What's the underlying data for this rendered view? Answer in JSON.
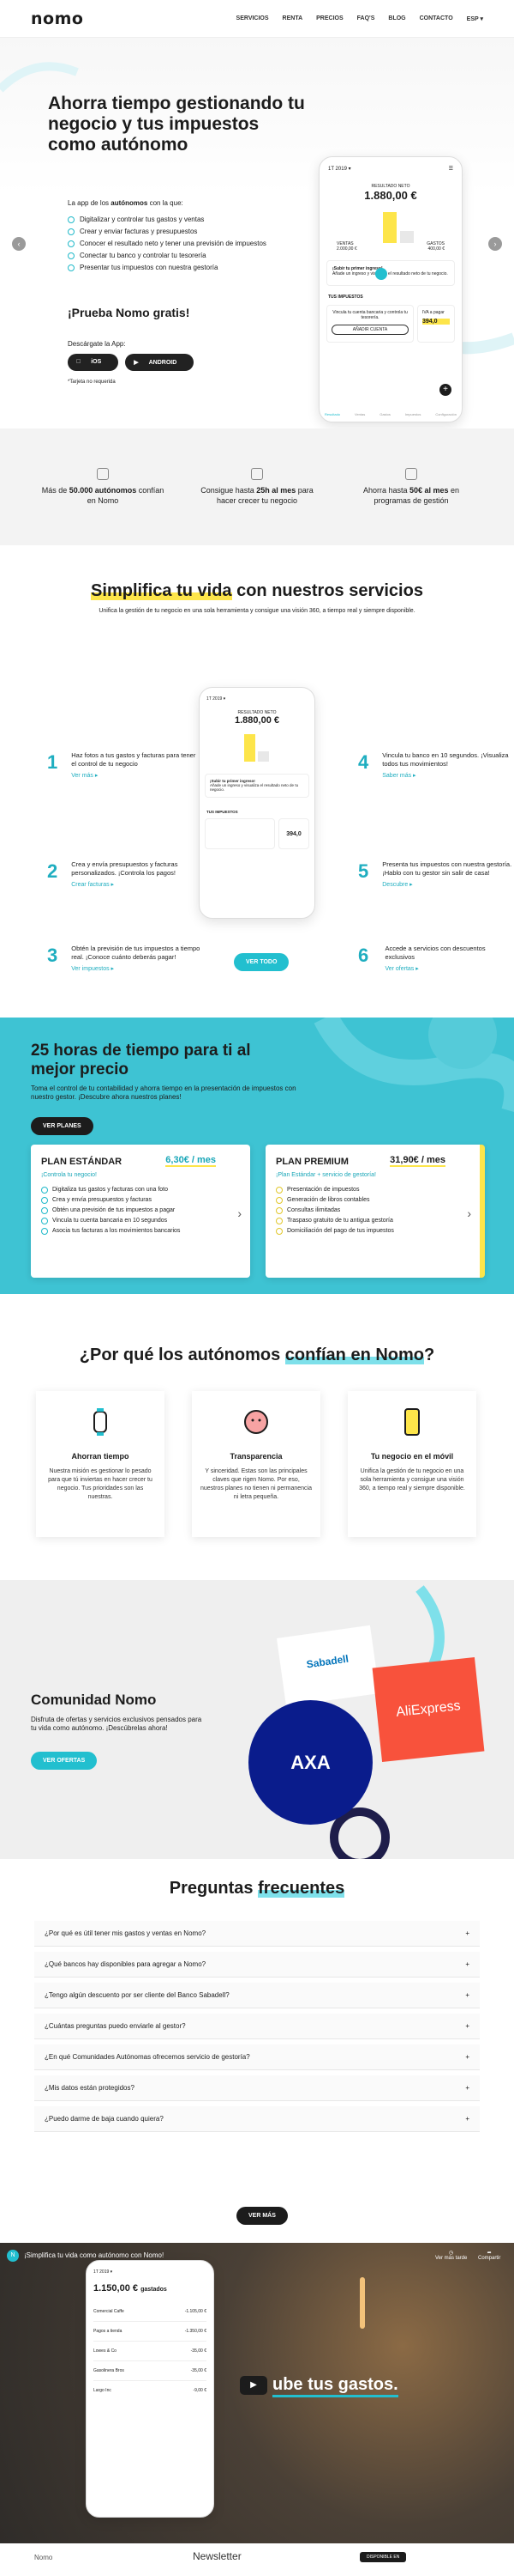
{
  "nav": {
    "logo": "nomo",
    "links": [
      "SERVICIOS",
      "RENTA",
      "PRECIOS",
      "FAQ'S",
      "BLOG",
      "CONTACTO",
      "ESP ▾"
    ]
  },
  "hero": {
    "title": "Ahorra tiempo gestionando tu negocio y tus impuestos como autónomo",
    "intro_pre": "La app de los ",
    "intro_bold": "autónomos",
    "intro_post": " con la que:",
    "bullets": [
      "Digitalizar y controlar tus gastos y ventas",
      "Crear y enviar facturas y presupuestos",
      "Conocer el resultado neto y tener una previsión de impuestos",
      "Conectar tu banco y controlar tu tesorería",
      "Presentar tus impuestos con nuestra gestoría"
    ],
    "try": "¡Prueba Nomo gratis!",
    "download": "Descárgate la App:",
    "ios": "iOS",
    "android": "ANDROID",
    "note": "*Tarjeta no requerida",
    "phone": {
      "date": "1T 2019 ▾",
      "label": "RESULTADO NETO",
      "amount": "1.880,00 €",
      "income_label": "VENTAS",
      "income": "2.000,00 €",
      "expense_label": "GASTOS",
      "expense": "400,00 €",
      "tip_title": "¡Subir tu primer ingreso!",
      "tip_text": "Añade un ingreso y visualiza el resultado neto de tu negocio.",
      "taxes": "TUS IMPUESTOS",
      "bank_text": "Vincula tu cuenta bancaria y controla tu tesorería.",
      "bank_btn": "AÑADIR CUENTA",
      "vat": "IVA a pagar",
      "vat_amount": "394,0",
      "tabs": [
        "Resultado",
        "Ventas",
        "Gastos",
        "Impuestos",
        "Configuración"
      ]
    }
  },
  "stats": [
    {
      "pre": "Más de ",
      "bold": "50.000 autónomos",
      "post": " confían en Nomo"
    },
    {
      "pre": "Consigue hasta ",
      "bold": "25h al mes",
      "post": " para hacer crecer tu negocio"
    },
    {
      "pre": "Ahorra hasta ",
      "bold": "50€ al mes",
      "post": " en programas de gestión"
    }
  ],
  "services": {
    "title_hl": "Simplifica tu vida",
    "title_rest": " con nuestros servicios",
    "sub": "Unifica la gestión de tu negocio en una sola herramienta y consigue una visión 360, a tiempo real y siempre disponible.",
    "items": [
      {
        "n": "1",
        "t": "Haz fotos a tus gastos y facturas para tener el control de tu negocio",
        "l": "Ver más ▸"
      },
      {
        "n": "2",
        "t": "Crea y envía presupuestos y facturas personalizados. ¡Controla los pagos!",
        "l": "Crear facturas ▸"
      },
      {
        "n": "3",
        "t": "Obtén la previsión de tus impuestos a tiempo real. ¡Conoce cuánto deberás pagar!",
        "l": "Ver impuestos ▸"
      },
      {
        "n": "4",
        "t": "Vincula tu banco en 10 segundos. ¡Visualiza todos tus movimientos!",
        "l": "Saber más ▸"
      },
      {
        "n": "5",
        "t": "Presenta tus impuestos con nuestra gestoría. ¡Hablo con tu gestor sin salir de casa!",
        "l": "Descubre ▸"
      },
      {
        "n": "6",
        "t": "Accede a servicios con descuentos exclusivos",
        "l": "Ver ofertas ▸"
      }
    ],
    "cta": "VER TODO"
  },
  "plans": {
    "title": "25 horas de tiempo para ti al mejor precio",
    "sub": "Toma el control de tu contabilidad y ahorra tiempo en la presentación de impuestos con nuestro gestor. ¡Descubre ahora nuestros planes!",
    "cta": "VER PLANES",
    "cards": [
      {
        "name": "PLAN ESTÁNDAR",
        "price": "6,30€ / mes",
        "sub": "¡Controla tu negocio!",
        "items": [
          "Digitaliza tus gastos y facturas con una foto",
          "Crea y envía presupuestos y facturas",
          "Obtén una previsión de tus impuestos a pagar",
          "Vincula tu cuenta bancaria en 10 segundos",
          "Asocia tus facturas a los movimientos bancarios"
        ]
      },
      {
        "name": "PLAN PREMIUM",
        "price": "31,90€ / mes",
        "sub": "¡Plan Estándar + servicio de gestoría!",
        "items": [
          "Presentación de impuestos",
          "Generación de libros contables",
          "Consultas ilimitadas",
          "Traspaso gratuito de tu antigua gestoría",
          "Domiciliación del pago de tus impuestos"
        ]
      }
    ]
  },
  "why": {
    "title_pre": "¿Por qué los autónomos ",
    "title_hl": "confían en Nomo",
    "title_post": "?",
    "cards": [
      {
        "t": "Ahorran tiempo",
        "d": "Nuestra misión es gestionar lo pesado para que tú inviertas en hacer crecer tu negocio. Tus prioridades son las nuestras."
      },
      {
        "t": "Transparencia",
        "d": "Y sinceridad. Estas son las principales claves que rigen Nomo. Por eso, nuestros planes no tienen ni permanencia ni letra pequeña."
      },
      {
        "t": "Tu negocio en el móvil",
        "d": "Unifica la gestión de tu negocio en una sola herramienta y consigue una visión 360, a tiempo real y siempre disponible."
      }
    ]
  },
  "community": {
    "title": "Comunidad Nomo",
    "text": "Disfruta de ofertas y servicios exclusivos pensados para tu vida como autónomo. ¡Descúbrelas ahora!",
    "cta": "VER OFERTAS",
    "brands": [
      "Sabadell",
      "AliExpress",
      "AXA"
    ]
  },
  "faq": {
    "title_pre": "Preguntas ",
    "title_hl": "frecuentes",
    "items": [
      "¿Por qué es útil tener mis gastos y ventas en Nomo?",
      "¿Qué bancos hay disponibles para agregar a Nomo?",
      "¿Tengo algún descuento por ser cliente del Banco Sabadell?",
      "¿Cuántas preguntas puedo enviarle al gestor?",
      "¿En qué Comunidades Autónomas ofrecemos servicio de gestoría?",
      "¿Mis datos están protegidos?",
      "¿Puedo darme de baja cuando quiera?"
    ],
    "plus": "+",
    "cta": "VER MÁS"
  },
  "video": {
    "title": "¡Simplifica tu vida como autónomo con Nomo!",
    "later": "Ver más tarde",
    "share": "Compartir",
    "caption": "ube tus gastos.",
    "amount": "1.150,00 €",
    "amount_label": "gastados",
    "rows": [
      [
        "Comercial Caffe",
        "-1.105,00 €"
      ],
      [
        "Pagos a tienda",
        "-1.350,00 €"
      ],
      [
        "Lowes & Co",
        "-35,00 €"
      ],
      [
        "Gasolinera Bros",
        "-35,00 €"
      ],
      [
        "Largo Inc",
        "-9,00 €"
      ]
    ]
  },
  "footer": {
    "logo": "Nomo",
    "newsletter": "Newsletter",
    "badge": "DISPONIBLE EN"
  },
  "colors": {
    "teal": "#22bfcf",
    "yellow": "#fde54a",
    "dark": "#1c1c1c"
  }
}
